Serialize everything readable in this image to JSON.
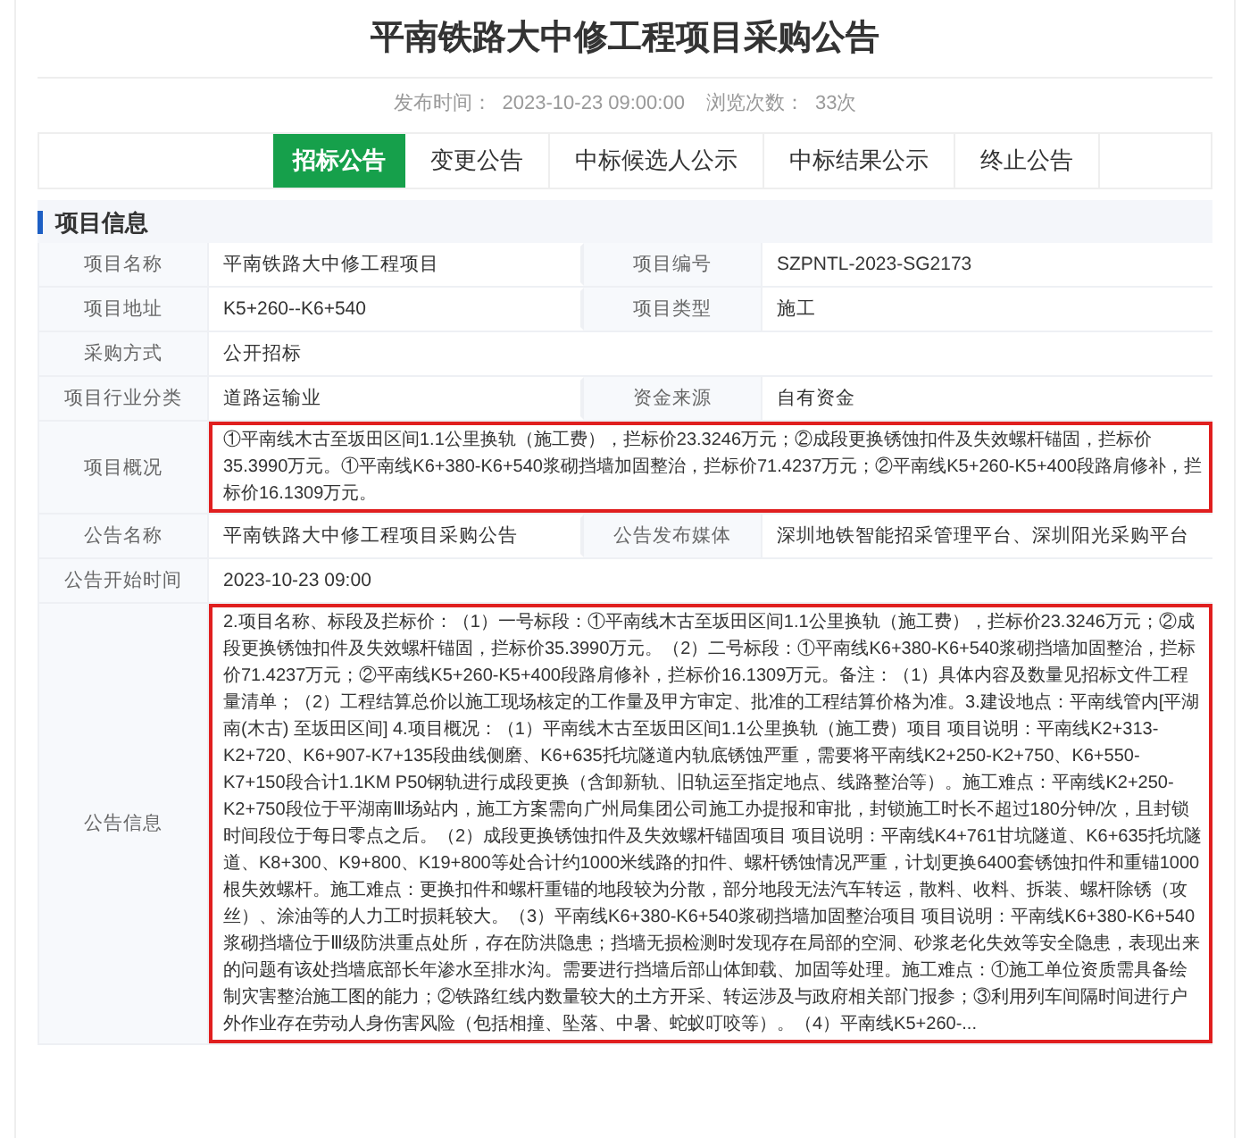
{
  "title": "平南铁路大中修工程项目采购公告",
  "meta": {
    "publish_label": "发布时间：",
    "publish_time": "2023-10-23 09:00:00",
    "views_label": "浏览次数：",
    "views": "33次"
  },
  "tabs": [
    {
      "label": "招标公告",
      "selected": true
    },
    {
      "label": "变更公告",
      "selected": false
    },
    {
      "label": "中标候选人公示",
      "selected": false
    },
    {
      "label": "中标结果公示",
      "selected": false
    },
    {
      "label": "终止公告",
      "selected": false
    }
  ],
  "section": {
    "title": "项目信息",
    "rows": [
      {
        "highlighted": false,
        "cells": [
          {
            "label": "项目名称",
            "value": "平南铁路大中修工程项目"
          },
          {
            "label": "项目编号",
            "value": "SZPNTL-2023-SG2173"
          }
        ]
      },
      {
        "highlighted": false,
        "cells": [
          {
            "label": "项目地址",
            "value": "K5+260--K6+540"
          },
          {
            "label": "项目类型",
            "value": "施工"
          }
        ]
      },
      {
        "highlighted": false,
        "cells": [
          {
            "label": "采购方式",
            "value": "公开招标"
          }
        ]
      },
      {
        "highlighted": false,
        "cells": [
          {
            "label": "项目行业分类",
            "value": "道路运输业"
          },
          {
            "label": "资金来源",
            "value": "自有资金"
          }
        ]
      },
      {
        "highlighted": true,
        "cells": [
          {
            "label": "项目概况",
            "value": "①平南线木古至坂田区间1.1公里换轨（施工费），拦标价23.3246万元；②成段更换锈蚀扣件及失效螺杆锚固，拦标价35.3990万元。①平南线K6+380-K6+540浆砌挡墙加固整治，拦标价71.4237万元；②平南线K5+260-K5+400段路肩修补，拦标价16.1309万元。"
          }
        ]
      },
      {
        "highlighted": false,
        "cells": [
          {
            "label": "公告名称",
            "value": "平南铁路大中修工程项目采购公告"
          },
          {
            "label": "公告发布媒体",
            "value": "深圳地铁智能招采管理平台、深圳阳光采购平台"
          }
        ]
      },
      {
        "highlighted": false,
        "cells": [
          {
            "label": "公告开始时间",
            "value": "2023-10-23 09:00"
          }
        ]
      },
      {
        "highlighted": true,
        "cells": [
          {
            "label": "公告信息",
            "value": "2.项目名称、标段及拦标价：（1）一号标段：①平南线木古至坂田区间1.1公里换轨（施工费），拦标价23.3246万元；②成段更换锈蚀扣件及失效螺杆锚固，拦标价35.3990万元。（2）二号标段：①平南线K6+380-K6+540浆砌挡墙加固整治，拦标价71.4237万元；②平南线K5+260-K5+400段路肩修补，拦标价16.1309万元。备注：（1）具体内容及数量见招标文件工程量清单；（2）工程结算总价以施工现场核定的工作量及甲方审定、批准的工程结算价格为准。3.建设地点：平南线管内[平湖南(木古) 至坂田区间] 4.项目概况：（1）平南线木古至坂田区间1.1公里换轨（施工费）项目 项目说明：平南线K2+313-K2+720、K6+907-K7+135段曲线侧磨、K6+635托坑隧道内轨底锈蚀严重，需要将平南线K2+250-K2+750、K6+550-K7+150段合计1.1KM P50钢轨进行成段更换（含卸新轨、旧轨运至指定地点、线路整治等）。施工难点：平南线K2+250-K2+750段位于平湖南Ⅲ场站内，施工方案需向广州局集团公司施工办提报和审批，封锁施工时长不超过180分钟/次，且封锁时间段位于每日零点之后。（2）成段更换锈蚀扣件及失效螺杆锚固项目 项目说明：平南线K4+761甘坑隧道、K6+635托坑隧道、K8+300、K9+800、K19+800等处合计约1000米线路的扣件、螺杆锈蚀情况严重，计划更换6400套锈蚀扣件和重锚1000根失效螺杆。施工难点：更换扣件和螺杆重锚的地段较为分散，部分地段无法汽车转运，散料、收料、拆装、螺杆除锈（攻丝）、涂油等的人力工时损耗较大。（3）平南线K6+380-K6+540浆砌挡墙加固整治项目 项目说明：平南线K6+380-K6+540浆砌挡墙位于Ⅲ级防洪重点处所，存在防洪隐患；挡墙无损检测时发现存在局部的空洞、砂浆老化失效等安全隐患，表现出来的问题有该处挡墙底部长年渗水至排水沟。需要进行挡墙后部山体卸载、加固等处理。施工难点：①施工单位资质需具备绘制灾害整治施工图的能力；②铁路红线内数量较大的土方开采、转运涉及与政府相关部门报参；③利用列车间隔时间进行户外作业存在劳动人身伤害风险（包括相撞、坠落、中暑、蛇蚁叮咬等）。（4）平南线K5+260-..."
          }
        ]
      }
    ]
  }
}
